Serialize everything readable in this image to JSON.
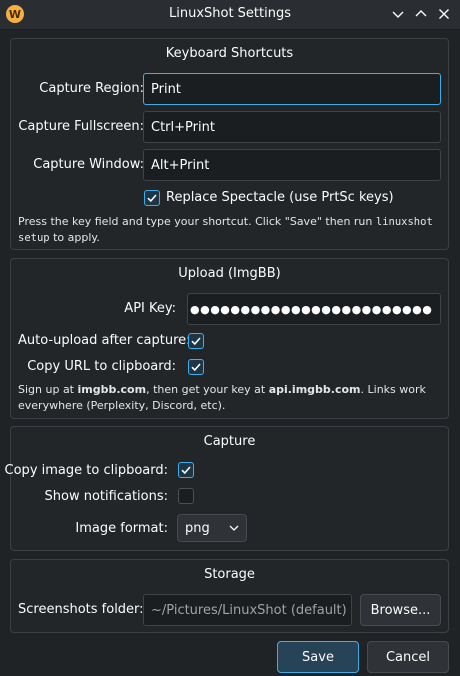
{
  "window": {
    "title": "LinuxShot Settings",
    "app_icon_letter": "W"
  },
  "keyboard": {
    "title": "Keyboard Shortcuts",
    "capture_region_label": "Capture Region:",
    "capture_region_value": "Print",
    "capture_fullscreen_label": "Capture Fullscreen:",
    "capture_fullscreen_value": "Ctrl+Print",
    "capture_window_label": "Capture Window:",
    "capture_window_value": "Alt+Print",
    "replace_spectacle_label": "Replace Spectacle (use PrtSc keys)",
    "replace_spectacle_checked": true,
    "hint_part1": "Press the key field and type your shortcut. Click \"Save\" then run ",
    "hint_code1": "linuxshot",
    "hint_code2": "setup",
    "hint_part2": " to apply."
  },
  "upload": {
    "title": "Upload (ImgBB)",
    "api_key_label": "API Key:",
    "api_key_value": "●●●●●●●●●●●●●●●●●●●●●●●●",
    "auto_upload_label": "Auto-upload after capture:",
    "auto_upload_checked": true,
    "copy_url_label": "Copy URL to clipboard:",
    "copy_url_checked": true,
    "hint_part1": "Sign up at ",
    "hint_link1": "imgbb.com",
    "hint_part2": ", then get your key at ",
    "hint_link2": "api.imgbb.com",
    "hint_part3": ". Links work",
    "hint_line2": "everywhere (Perplexity, Discord, etc)."
  },
  "capture": {
    "title": "Capture",
    "copy_image_label": "Copy image to clipboard:",
    "copy_image_checked": true,
    "show_notifications_label": "Show notifications:",
    "show_notifications_checked": false,
    "image_format_label": "Image format:",
    "image_format_value": "png"
  },
  "storage": {
    "title": "Storage",
    "folder_label": "Screenshots folder:",
    "folder_placeholder": "~/Pictures/LinuxShot (default)",
    "browse_label": "Browse..."
  },
  "footer": {
    "save_label": "Save",
    "cancel_label": "Cancel"
  },
  "colors": {
    "accent": "#3daee9",
    "window_bg": "#202326",
    "field_bg": "#1b1e20"
  }
}
